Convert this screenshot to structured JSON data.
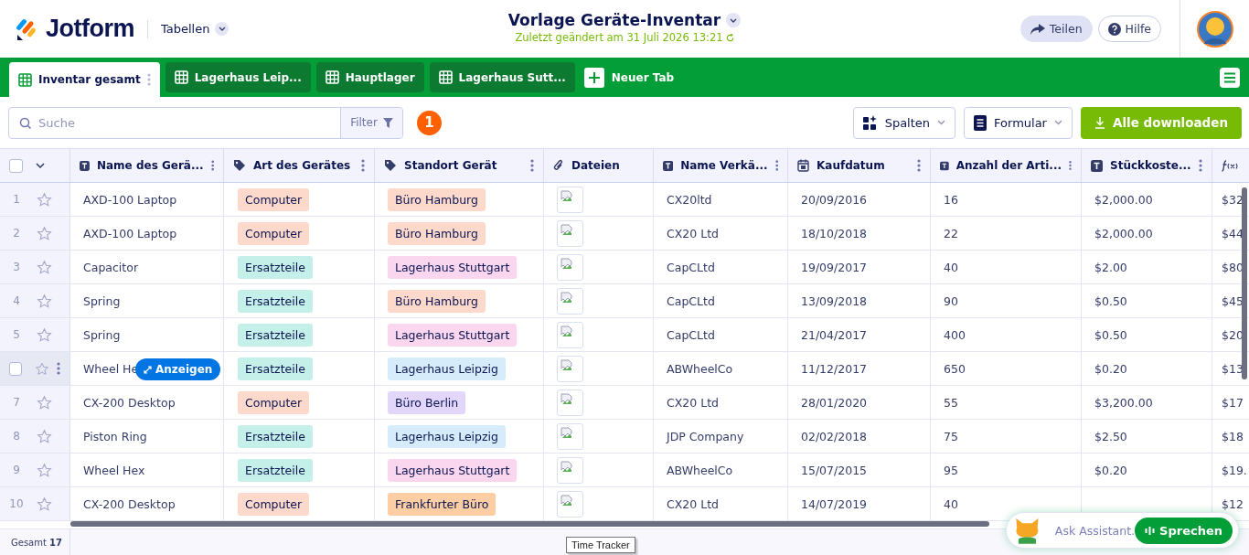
{
  "header": {
    "logo": "Jotform",
    "section": "Tabellen",
    "title": "Vorlage Geräte-Inventar",
    "subtitle": "Zuletzt geändert am 31 Juli 2026 13:21",
    "buttons": [
      {
        "label": "Teilen",
        "kind": "share"
      },
      {
        "label": "Hilfe",
        "kind": "help"
      }
    ]
  },
  "tabs": [
    {
      "label": "Inventar gesamt",
      "selected": true
    },
    {
      "label": "Lagerhaus Leip...",
      "selected": false
    },
    {
      "label": "Hauptlager",
      "selected": false
    },
    {
      "label": "Lagerhaus Sutt...",
      "selected": false
    }
  ],
  "new_tab": "Neuer Tab",
  "toolbar": {
    "search_placeholder": "Suche",
    "filter": "Filter",
    "filter_badge": "1",
    "columns": "Spalten",
    "form": "Formular",
    "download": "Alle downloaden"
  },
  "table": {
    "all_selected": false,
    "columns": [
      {
        "label": "Name des Gerä...",
        "kind": "text"
      },
      {
        "label": "Art des Gerätes",
        "kind": "tag"
      },
      {
        "label": "Standort Gerät",
        "kind": "tag"
      },
      {
        "label": "Dateien",
        "kind": "file"
      },
      {
        "label": "Name Verkä...",
        "kind": "text"
      },
      {
        "label": "Kaufdatum",
        "kind": "date"
      },
      {
        "label": "Anzahl der Arti...",
        "kind": "text"
      },
      {
        "label": "Stückkoste...",
        "kind": "text"
      },
      {
        "kind": "formula"
      }
    ],
    "rows": [
      {
        "number": "1",
        "hovered": false,
        "starred": false,
        "name": "AXD-100 Laptop",
        "type": {
          "label": "Computer",
          "color": "#fdd9cc"
        },
        "location": {
          "label": "Büro Hamburg",
          "color": "#fdd9cc"
        },
        "vendor": "CX20ltd",
        "date": "20/09/2016",
        "quantity": "16",
        "cost": "$2,000.00",
        "column_10": "$32"
      },
      {
        "number": "2",
        "hovered": false,
        "starred": false,
        "name": "AXD-100 Laptop",
        "type": {
          "label": "Computer",
          "color": "#fdd9cc"
        },
        "location": {
          "label": "Büro Hamburg",
          "color": "#fdd9cc"
        },
        "vendor": "CX20 Ltd",
        "date": "18/10/2018",
        "quantity": "22",
        "cost": "$2,000.00",
        "column_10": "$44"
      },
      {
        "number": "3",
        "hovered": false,
        "starred": false,
        "name": "Capacitor",
        "type": {
          "label": "Ersatzteile",
          "color": "#c5efe9"
        },
        "location": {
          "label": "Lagerhaus Stuttgart",
          "color": "#fbd6ef"
        },
        "vendor": "CapCLtd",
        "date": "19/09/2017",
        "quantity": "40",
        "cost": "$2.00",
        "column_10": "$80"
      },
      {
        "number": "4",
        "hovered": false,
        "starred": false,
        "name": "Spring",
        "type": {
          "label": "Ersatzteile",
          "color": "#c5efe9"
        },
        "location": {
          "label": "Büro Hamburg",
          "color": "#fdd9cc"
        },
        "vendor": "CapCLtd",
        "date": "13/09/2018",
        "quantity": "90",
        "cost": "$0.50",
        "column_10": "$45"
      },
      {
        "number": "5",
        "hovered": false,
        "starred": false,
        "name": "Spring",
        "type": {
          "label": "Ersatzteile",
          "color": "#c5efe9"
        },
        "location": {
          "label": "Lagerhaus Stuttgart",
          "color": "#fbd6ef"
        },
        "vendor": "CapCLtd",
        "date": "21/04/2017",
        "quantity": "400",
        "cost": "$0.50",
        "column_10": "$20"
      },
      {
        "hovered": true,
        "selected": false,
        "starred": false,
        "name": "Wheel He",
        "open_button": "Anzeigen",
        "type": {
          "label": "Ersatzteile",
          "color": "#c5efe9"
        },
        "location": {
          "label": "Lagerhaus Leipzig",
          "color": "#d6ecfb"
        },
        "vendor": "ABWheelCo",
        "date": "11/12/2017",
        "quantity": "650",
        "cost": "$0.20",
        "column_10": "$13"
      },
      {
        "number": "7",
        "hovered": false,
        "starred": false,
        "name": "CX-200 Desktop",
        "type": {
          "label": "Computer",
          "color": "#fdd9cc"
        },
        "location": {
          "label": "Büro Berlin",
          "color": "#e3d6fb"
        },
        "vendor": "CX20 Ltd",
        "date": "28/01/2020",
        "quantity": "55",
        "cost": "$3,200.00",
        "column_10": "$17"
      },
      {
        "number": "8",
        "hovered": false,
        "starred": false,
        "name": "Piston Ring",
        "type": {
          "label": "Ersatzteile",
          "color": "#c5efe9"
        },
        "location": {
          "label": "Lagerhaus Leipzig",
          "color": "#d6ecfb"
        },
        "vendor": "JDP Company",
        "date": "02/02/2018",
        "quantity": "75",
        "cost": "$2.50",
        "column_10": "$18"
      },
      {
        "number": "9",
        "hovered": false,
        "starred": false,
        "name": "Wheel Hex",
        "type": {
          "label": "Ersatzteile",
          "color": "#c5efe9"
        },
        "location": {
          "label": "Lagerhaus Stuttgart",
          "color": "#fbd6ef"
        },
        "vendor": "ABWheelCo",
        "date": "15/07/2015",
        "quantity": "95",
        "cost": "$0.20",
        "column_10": "$19."
      },
      {
        "number": "10",
        "hovered": false,
        "starred": false,
        "name": "CX-200 Desktop",
        "type": {
          "label": "Computer",
          "color": "#fdd9cc"
        },
        "location": {
          "label": "Frankfurter Büro",
          "color": "#fdcda3"
        },
        "vendor": "CX20 Ltd",
        "date": "14/07/2019",
        "quantity": "40",
        "column_10": "$12"
      }
    ]
  },
  "footer": {
    "total_label": "Gesamt",
    "total": "17"
  },
  "tooltip": "Time Tracker",
  "assistant": {
    "placeholder": "Ask Assistant.",
    "button": "Sprechen"
  }
}
